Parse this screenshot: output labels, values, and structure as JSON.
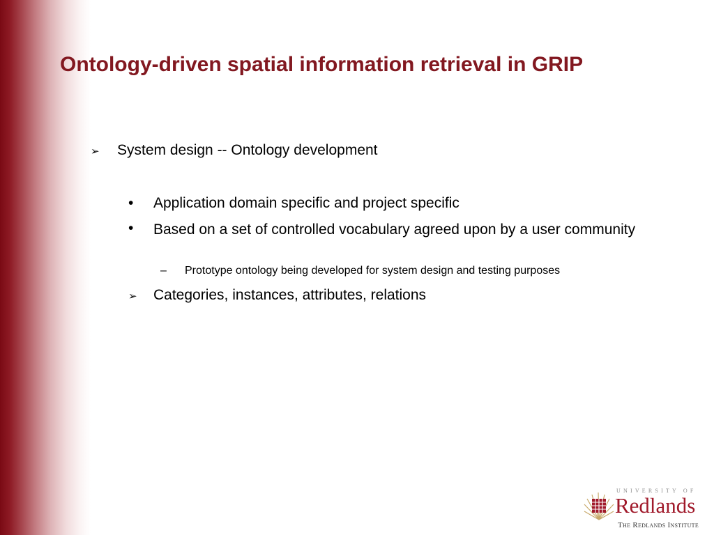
{
  "slide": {
    "title": "Ontology-driven spatial information retrieval in GRIP",
    "bullets": [
      {
        "marker": "➢",
        "text": "System design -- Ontology development"
      },
      {
        "marker": "•",
        "text": "Application domain specific and project specific"
      },
      {
        "marker": "•",
        "text": "Based on a set of controlled vocabulary agreed upon by a user community"
      },
      {
        "marker": "–",
        "text": "Prototype ontology being developed for system design and testing purposes"
      },
      {
        "marker": "➢",
        "text": "Categories, instances, attributes, relations"
      }
    ]
  },
  "logo": {
    "university_of": "UNIVERSITY OF",
    "name": "Redlands",
    "institute": "The Redlands Institute"
  },
  "colors": {
    "title": "#821820",
    "accent": "#7a0a14",
    "logo_red": "#a0192a"
  }
}
